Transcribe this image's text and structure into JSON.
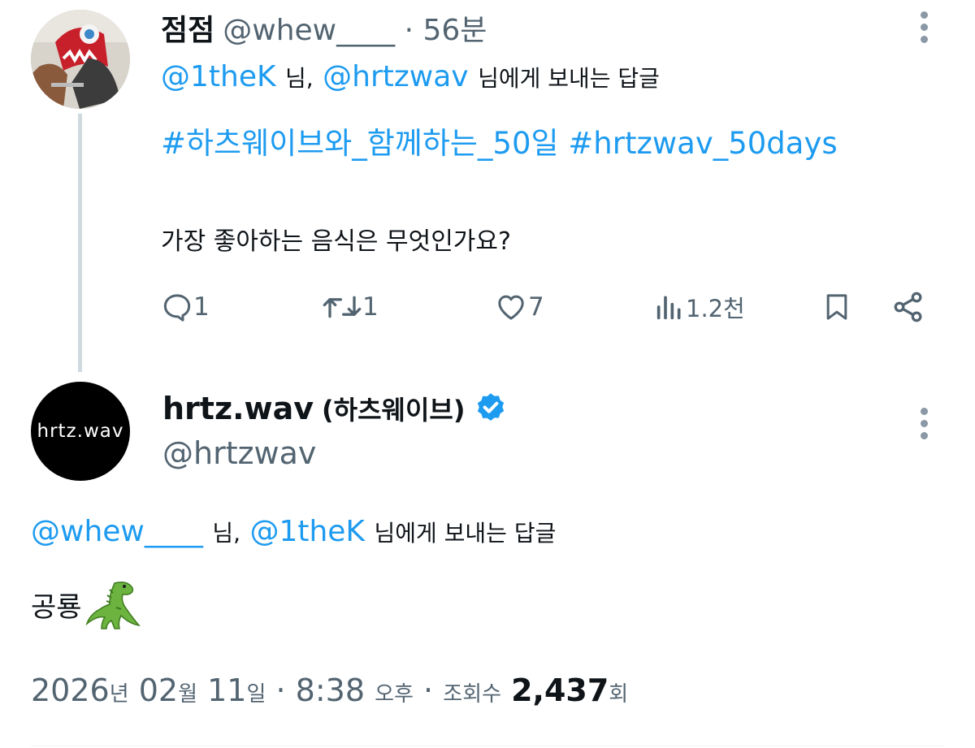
{
  "tweet1": {
    "display_name": "점점",
    "handle": "@whew____",
    "separator": "·",
    "time": "56분",
    "reply_to": {
      "mention1": "@1theK",
      "sep": "님,",
      "mention2": "@hrtzwav",
      "suffix": "님에게 보내는 답글"
    },
    "hashtag1": "#하츠웨이브와_함께하는_50일",
    "hashtag2": "#hrtzwav_50days",
    "text": "가장 좋아하는 음식은 무엇인가요?",
    "actions": {
      "replies": "1",
      "reposts": "1",
      "likes": "7",
      "views": "1.2천"
    },
    "icons": [
      "reply-icon",
      "repost-icon",
      "like-icon",
      "views-icon",
      "bookmark-icon",
      "share-icon",
      "more-icon"
    ]
  },
  "tweet2": {
    "avatar_text": "hrtz.wav",
    "display_name": "hrtz.wav",
    "display_name_paren": "(하츠웨이브)",
    "handle": "@hrtzwav",
    "reply_to": {
      "mention1": "@whew____",
      "sep": "님,",
      "mention2": "@1theK",
      "suffix": "님에게 보내는 답글"
    },
    "text": "공룡",
    "emoji_icon": "dinosaur-icon",
    "meta": {
      "year": "2026",
      "year_unit": "년",
      "month": "02",
      "month_unit": "월",
      "day": "11",
      "day_unit": "일",
      "dot": "·",
      "time": "8:38",
      "ampm": "오후",
      "dot2": "·",
      "views_label": "조회수",
      "views": "2,437",
      "views_unit": "회"
    }
  },
  "colors": {
    "accent": "#1d9bf0",
    "secondary_text": "#536471",
    "primary_text": "#0f1419",
    "thread_line": "#cfd9de"
  }
}
